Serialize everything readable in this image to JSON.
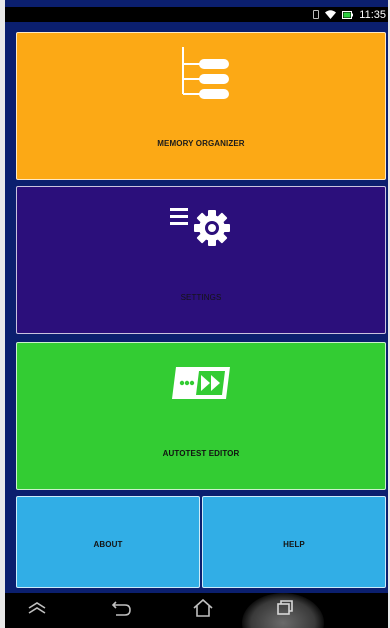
{
  "status_bar": {
    "time": "11:35"
  },
  "tiles": {
    "memory_organizer": {
      "label": "MEMORY ORGANIZER",
      "color": "#fca915"
    },
    "settings": {
      "label": "SETTINGS",
      "color": "#2b0f7b"
    },
    "autotest_editor": {
      "label": "AUTOTEST EDITOR",
      "color": "#33cc33"
    },
    "about": {
      "label": "ABOUT",
      "color": "#31aee6"
    },
    "help": {
      "label": "HELP",
      "color": "#31aee6"
    }
  },
  "nav_bar": {
    "buttons": [
      "menu-up-icon",
      "back-icon",
      "home-icon",
      "recent-apps-icon"
    ]
  },
  "colors": {
    "background": "#0b1f6e",
    "tile_border": "#ffffff"
  }
}
